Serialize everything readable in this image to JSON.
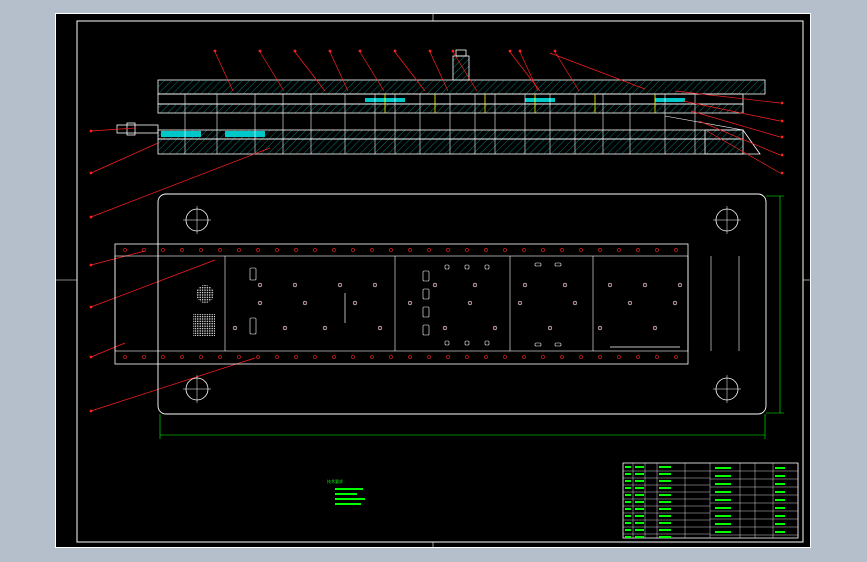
{
  "canvas": {
    "background_color": "#b5bfcc",
    "sheet_color": "#000000",
    "colors": {
      "outline": "#ffffff",
      "leader": "#ff2020",
      "hatch": "#00c8c8",
      "dimension": "#00ff00",
      "notes": "#00ff00",
      "hidden": "#ffff00"
    }
  },
  "drawing": {
    "type": "cad-assembly-drawing",
    "views": [
      "section-view",
      "plan-view",
      "title-block"
    ],
    "balloon_count_top": 13,
    "balloon_count_right": 5,
    "balloon_count_left": 7,
    "mounting_hole_icons": [
      "circle-crosshair-icon",
      "circle-crosshair-icon",
      "circle-crosshair-icon",
      "circle-crosshair-icon"
    ]
  },
  "technical_notes": {
    "title": "技术要求",
    "lines": [
      "1.",
      "2.",
      "3.",
      "4."
    ]
  },
  "title_block": {
    "label": "title-block"
  }
}
